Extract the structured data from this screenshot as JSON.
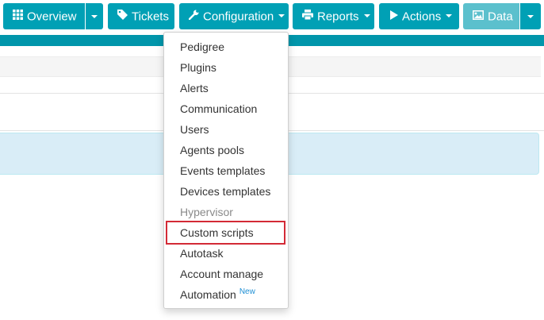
{
  "navbar": {
    "overview_label": "Overview",
    "tickets_label": "Tickets",
    "configuration_label": "Configuration",
    "reports_label": "Reports",
    "actions_label": "Actions",
    "data_label": "Data"
  },
  "configuration_menu": {
    "items": [
      {
        "label": "Pedigree"
      },
      {
        "label": "Plugins"
      },
      {
        "label": "Alerts"
      },
      {
        "label": "Communication"
      },
      {
        "label": "Users"
      },
      {
        "label": "Agents pools"
      },
      {
        "label": "Events templates"
      },
      {
        "label": "Devices templates"
      },
      {
        "label": "Hypervisor"
      },
      {
        "label": "Custom scripts"
      },
      {
        "label": "Autotask"
      },
      {
        "label": "Account manage"
      },
      {
        "label": "Automation",
        "badge": "New"
      }
    ]
  },
  "colors": {
    "button": "#00a0b5",
    "button_active": "#5bc0cd",
    "teal_bar": "#0196ab",
    "info_box": "#d9edf7",
    "highlight": "#d32a36",
    "new_badge": "#1e8fd4"
  }
}
